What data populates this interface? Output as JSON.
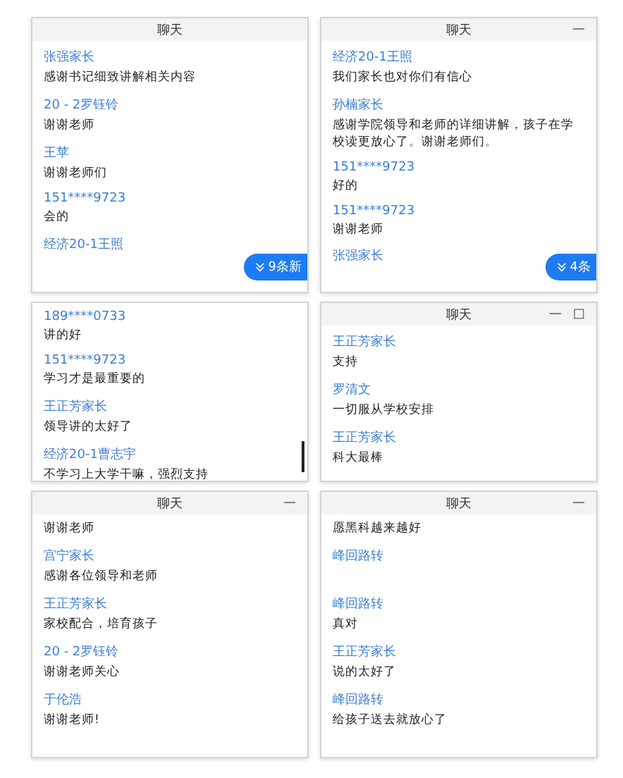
{
  "panels": [
    {
      "title": "聊天",
      "messages": [
        {
          "name": "张强家长",
          "text": "感谢书记细致讲解相关内容"
        },
        {
          "name": "20 - 2罗钰铃",
          "text": "谢谢老师"
        },
        {
          "name": "王苹",
          "text": "谢谢老师们"
        },
        {
          "name": "151****9723",
          "text": "会的"
        },
        {
          "name": "经济20-1王照"
        }
      ],
      "badge": "9条新"
    },
    {
      "title": "聊天",
      "controls": [
        "—"
      ],
      "messages": [
        {
          "name": "经济20-1王照",
          "text": "我们家长也对你们有信心"
        },
        {
          "name": "孙楠家长",
          "text": "感谢学院领导和老师的详细讲解，孩子在学校读更放心了。谢谢老师们。"
        },
        {
          "name": "151****9723",
          "text": "好的"
        },
        {
          "name": "151****9723",
          "text": "谢谢老师"
        },
        {
          "name": "张强家长"
        }
      ],
      "badge": "4条"
    },
    {
      "messages": [
        {
          "name": "189****0733",
          "text": "讲的好"
        },
        {
          "name": "151****9723",
          "text": "学习才是最重要的"
        },
        {
          "name": "王正芳家长",
          "text": "领导讲的太好了"
        },
        {
          "name": "经济20-1曹志宇",
          "text": "不学习上大学干嘛，强烈支持"
        }
      ],
      "scrollbar": true
    },
    {
      "title": "聊天",
      "controls": [
        "—",
        "□"
      ],
      "messages": [
        {
          "name": "王正芳家长",
          "text": "支持"
        },
        {
          "name": "罗清文",
          "text": "一切服从学校安排"
        },
        {
          "name": "王正芳家长",
          "text": "科大最棒"
        }
      ]
    },
    {
      "title": "聊天",
      "controls": [
        "—"
      ],
      "messages": [
        {
          "text": "谢谢老师"
        },
        {
          "name": "宫宁家长",
          "text": "感谢各位领导和老师"
        },
        {
          "name": "王正芳家长",
          "text": "家校配合，培育孩子"
        },
        {
          "name": "20 - 2罗钰铃",
          "text": "谢谢老师关心"
        },
        {
          "name": "于伦浩",
          "text": "谢谢老师!"
        }
      ]
    },
    {
      "title": "聊天",
      "controls": [
        "—"
      ],
      "messages": [
        {
          "text": "愿黑科越来越好"
        },
        {
          "name": "峰回路转"
        },
        {
          "name": "峰回路转",
          "text": "真对"
        },
        {
          "name": "王正芳家长",
          "text": "说的太好了"
        },
        {
          "name": "峰回路转",
          "text": "给孩子送去就放心了"
        }
      ]
    }
  ]
}
